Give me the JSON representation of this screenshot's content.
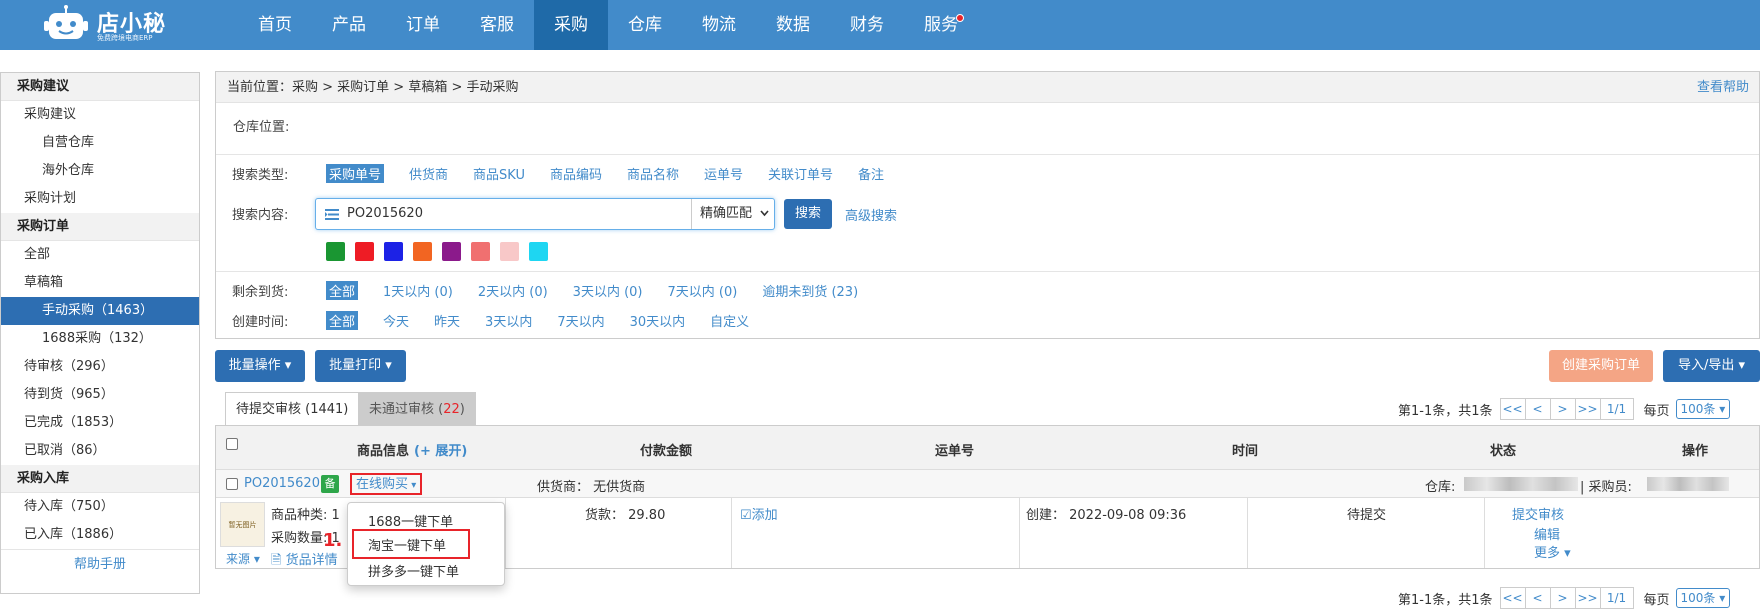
{
  "logo": {
    "name": "店小秘",
    "sub": "免费跨境电商ERP"
  },
  "nav": [
    {
      "label": "首页",
      "active": false
    },
    {
      "label": "产品",
      "active": false
    },
    {
      "label": "订单",
      "active": false
    },
    {
      "label": "客服",
      "active": false
    },
    {
      "label": "采购",
      "active": true
    },
    {
      "label": "仓库",
      "active": false
    },
    {
      "label": "物流",
      "active": false
    },
    {
      "label": "数据",
      "active": false
    },
    {
      "label": "财务",
      "active": false
    },
    {
      "label": "服务",
      "active": false
    }
  ],
  "sidebar": {
    "items": [
      {
        "label": "采购建议",
        "type": "head"
      },
      {
        "label": "采购建议",
        "type": "l1"
      },
      {
        "label": "自营仓库",
        "type": "l2"
      },
      {
        "label": "海外仓库",
        "type": "l2"
      },
      {
        "label": "采购计划",
        "type": "l1"
      },
      {
        "label": "采购订单",
        "type": "head"
      },
      {
        "label": "全部",
        "type": "l1"
      },
      {
        "label": "草稿箱",
        "type": "l1"
      },
      {
        "label": "手动采购（1463）",
        "type": "l2",
        "active": true
      },
      {
        "label": "1688采购（132）",
        "type": "l2"
      },
      {
        "label": "待审核（296）",
        "type": "l1"
      },
      {
        "label": "待到货（965）",
        "type": "l1"
      },
      {
        "label": "已完成（1853）",
        "type": "l1"
      },
      {
        "label": "已取消（86）",
        "type": "l1"
      },
      {
        "label": "采购入库",
        "type": "head"
      },
      {
        "label": "待入库（750）",
        "type": "l1"
      },
      {
        "label": "已入库（1886）",
        "type": "l1"
      }
    ],
    "help": "帮助手册"
  },
  "breadcrumb": {
    "text": "当前位置：采购 > 采购订单 > 草稿箱 > 手动采购",
    "help": "查看帮助"
  },
  "filters": {
    "warehouse_label": "仓库位置:",
    "search_type_label": "搜索类型:",
    "search_types": [
      "采购单号",
      "供货商",
      "商品SKU",
      "商品编码",
      "商品名称",
      "运单号",
      "关联订单号",
      "备注"
    ],
    "search_content_label": "搜索内容:",
    "search_value": "PO2015620",
    "match_mode": "精确匹配",
    "search_button": "搜索",
    "advanced": "高级搜索",
    "swatch_colors": [
      "#1a9632",
      "#ee1c25",
      "#1c22e6",
      "#f26522",
      "#8b1a8b",
      "#f07070",
      "#f8c8c8",
      "#1ed6f2"
    ],
    "remaining_label": "剩余到货:",
    "remaining_opts": [
      "全部",
      "1天以内 (0)",
      "2天以内 (0)",
      "3天以内 (0)",
      "7天以内 (0)",
      "逾期未到货 (23)"
    ],
    "created_label": "创建时间:",
    "created_opts": [
      "全部",
      "今天",
      "昨天",
      "3天以内",
      "7天以内",
      "30天以内",
      "自定义"
    ]
  },
  "toolbar": {
    "bulk_ops": "批量操作",
    "bulk_print": "批量打印",
    "create_order": "创建采购订单",
    "import_export": "导入/导出"
  },
  "tabs": {
    "pending": "待提交审核 (1441)",
    "rejected_label": "未通过审核 (",
    "rejected_count": "22",
    "rejected_close": ")"
  },
  "pager": {
    "summary": "第1-1条，共1条",
    "first": "<<",
    "prev": "<",
    "next": ">",
    "last": ">>",
    "page": "1/1",
    "per_page_label": "每页",
    "per_page": "100条"
  },
  "table": {
    "headers": {
      "product": "商品信息",
      "expand": "(+ 展开)",
      "amount": "付款金额",
      "tracking": "运单号",
      "time": "时间",
      "status": "状态",
      "ops": "操作"
    },
    "order": {
      "id": "PO2015620",
      "badge": "备",
      "online_buy": "在线购买",
      "supplier": "供货商：  无供货商",
      "warehouse_label": "仓库:",
      "buyer_label": "| 采购员:",
      "product_type": "商品种类: 1",
      "qty": "采购数量: 1",
      "source": "来源",
      "details": "货品详情",
      "image_text": "暂无图片",
      "goods_amount": "货款：  29.80",
      "add": "添加",
      "created": "创建：  2022-09-08 09:36",
      "status": "待提交",
      "op_submit": "提交审核",
      "op_edit": "编辑",
      "op_more": "更多"
    }
  },
  "dropdown": {
    "items": [
      "1688一键下单",
      "淘宝一键下单",
      "拼多多一键下单"
    ],
    "marker": "1."
  }
}
